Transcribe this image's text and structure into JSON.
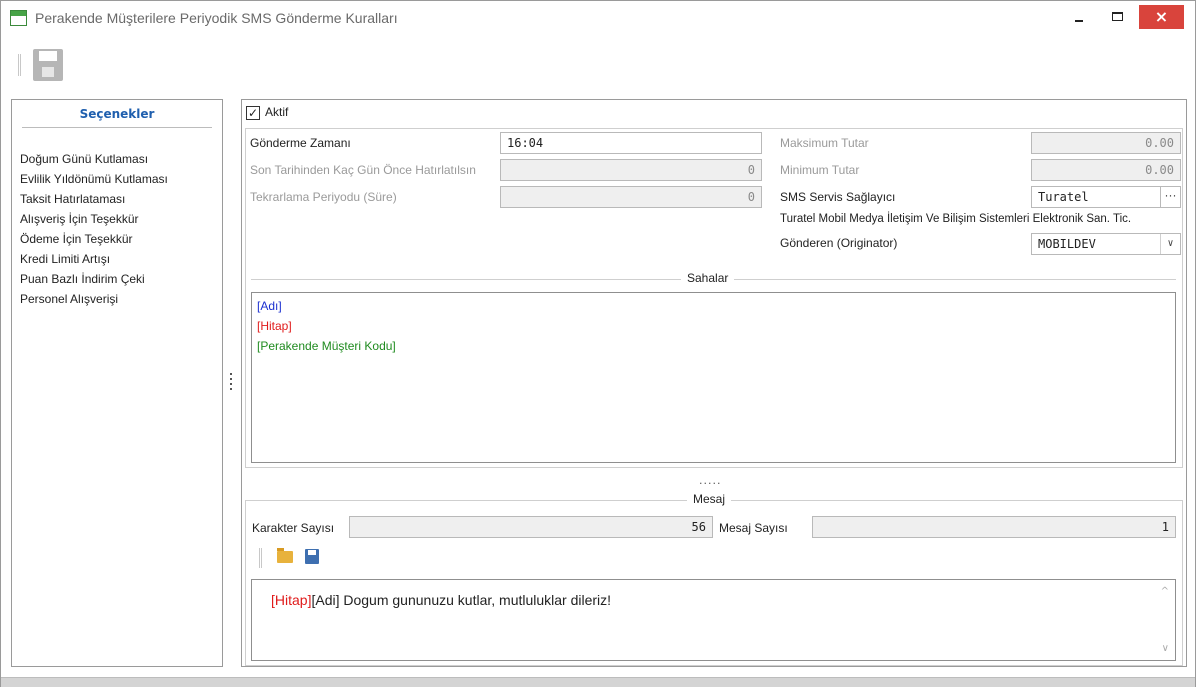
{
  "window": {
    "title": "Perakende Müşterilere Periyodik SMS Gönderme Kuralları",
    "close_glyph": "×"
  },
  "left": {
    "header": "Seçenekler",
    "items": [
      "Doğum Günü Kutlaması",
      "Evlilik Yıldönümü Kutlaması",
      "Taksit Hatırlataması",
      "Alışveriş İçin Teşekkür",
      "Ödeme İçin Teşekkür",
      "Kredi Limiti Artışı",
      "Puan Bazlı İndirim Çeki",
      "Personel Alışverişi"
    ]
  },
  "form": {
    "aktif_label": "Aktif",
    "aktif_checked": "✓",
    "gonderme_label": "Gönderme Zamanı",
    "gonderme_value": "16:04",
    "son_tarih_label": "Son Tarihinden Kaç Gün Önce Hatırlatılsın",
    "son_tarih_value": "0",
    "tekrar_label": "Tekrarlama Periyodu (Süre)",
    "tekrar_value": "0",
    "maks_label": "Maksimum Tutar",
    "maks_value": "0.00",
    "min_label": "Minimum Tutar",
    "min_value": "0.00",
    "sms_label": "SMS Servis Sağlayıcı",
    "sms_value": "Turatel",
    "sms_ellipsis": "···",
    "provider_full": "Turatel Mobil Medya İletişim Ve Bilişim Sistemleri Elektronik San. Tic.",
    "originator_label": "Gönderen (Originator)",
    "originator_value": "MOBILDEV",
    "originator_arrow": "∨"
  },
  "sahalar": {
    "title": "Sahalar",
    "tokens": [
      "[Adı]",
      "[Hitap]",
      "[Perakende Müşteri Kodu]"
    ]
  },
  "splitter": "·····",
  "mesaj": {
    "title": "Mesaj",
    "karakter_label": "Karakter Sayısı",
    "karakter_value": "56",
    "mesaj_sayisi_label": "Mesaj Sayısı",
    "mesaj_sayisi_value": "1",
    "text_hitap": "[Hitap]",
    "text_rest": "[Adi] Dogum gununuzu kutlar, mutluluklar dileriz!",
    "scroll_up": "^",
    "scroll_down": "∨"
  },
  "colors": {
    "header_blue": "#1f5fae",
    "token_blue": "#1a2fd0",
    "token_red": "#e01b1b",
    "token_green": "#1f8b1f",
    "close_red": "#d9443c"
  }
}
